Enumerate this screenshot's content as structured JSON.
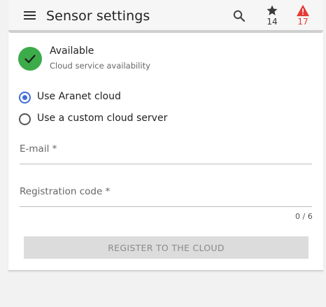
{
  "header": {
    "title": "Sensor settings",
    "menu_icon": "hamburger-menu-icon",
    "search_icon": "search-icon",
    "favorites": {
      "icon": "star-icon",
      "count": "14"
    },
    "alerts": {
      "icon": "warning-icon",
      "count": "17",
      "color": "#e53935"
    }
  },
  "status": {
    "icon": "checkmark-icon",
    "color": "#3cab4a",
    "title": "Available",
    "subtitle": "Cloud service availability"
  },
  "cloud_options": {
    "selected": "Use Aranet cloud",
    "options": [
      {
        "label": "Use Aranet cloud",
        "checked": true
      },
      {
        "label": "Use a custom cloud server",
        "checked": false
      }
    ],
    "accent_color": "#3f6fd6"
  },
  "form": {
    "email": {
      "label": "E-mail *",
      "value": ""
    },
    "registration_code": {
      "label": "Registration code *",
      "value": "",
      "counter": "0 / 6"
    }
  },
  "register_button": {
    "label": "REGISTER TO THE CLOUD",
    "enabled": false
  }
}
